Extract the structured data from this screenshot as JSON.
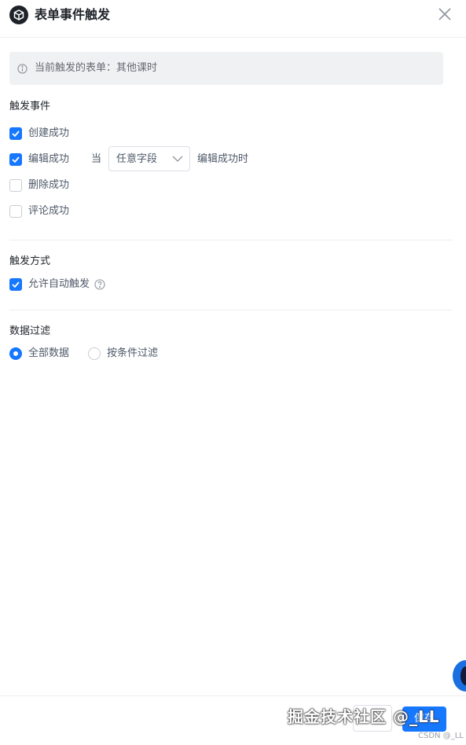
{
  "header": {
    "title": "表单事件触发",
    "logo_icon": "cube-icon",
    "close_icon": "close-icon"
  },
  "info": {
    "icon": "info-circle-icon",
    "text": "当前触发的表单：其他课时"
  },
  "trigger_events": {
    "title": "触发事件",
    "items": [
      {
        "label": "创建成功",
        "checked": true
      },
      {
        "label": "编辑成功",
        "checked": true
      },
      {
        "label": "删除成功",
        "checked": false
      },
      {
        "label": "评论成功",
        "checked": false
      }
    ],
    "edit_condition": {
      "prefix": "当",
      "selected": "任意字段",
      "suffix": "编辑成功时"
    }
  },
  "trigger_mode": {
    "title": "触发方式",
    "auto": {
      "label": "允许自动触发",
      "checked": true,
      "help_icon": "question-circle-icon"
    }
  },
  "data_filter": {
    "title": "数据过滤",
    "options": [
      {
        "label": "全部数据",
        "selected": true
      },
      {
        "label": "按条件过滤",
        "selected": false
      }
    ]
  },
  "footer": {
    "save_label": "保存",
    "watermark": "掘金技术社区 @_LL",
    "csdn": "CSDN @_LL"
  },
  "colors": {
    "primary": "#1677ff",
    "text": "#1f2329",
    "muted": "#646a73",
    "border": "#dcdfe6"
  }
}
